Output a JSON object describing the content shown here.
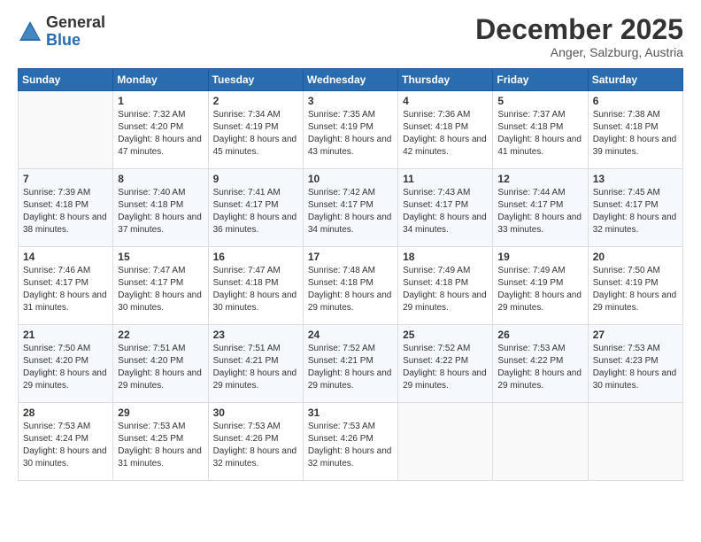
{
  "logo": {
    "general": "General",
    "blue": "Blue"
  },
  "header": {
    "month": "December 2025",
    "location": "Anger, Salzburg, Austria"
  },
  "weekdays": [
    "Sunday",
    "Monday",
    "Tuesday",
    "Wednesday",
    "Thursday",
    "Friday",
    "Saturday"
  ],
  "weeks": [
    [
      {
        "day": "",
        "sunrise": "",
        "sunset": "",
        "daylight": ""
      },
      {
        "day": "1",
        "sunrise": "Sunrise: 7:32 AM",
        "sunset": "Sunset: 4:20 PM",
        "daylight": "Daylight: 8 hours and 47 minutes."
      },
      {
        "day": "2",
        "sunrise": "Sunrise: 7:34 AM",
        "sunset": "Sunset: 4:19 PM",
        "daylight": "Daylight: 8 hours and 45 minutes."
      },
      {
        "day": "3",
        "sunrise": "Sunrise: 7:35 AM",
        "sunset": "Sunset: 4:19 PM",
        "daylight": "Daylight: 8 hours and 43 minutes."
      },
      {
        "day": "4",
        "sunrise": "Sunrise: 7:36 AM",
        "sunset": "Sunset: 4:18 PM",
        "daylight": "Daylight: 8 hours and 42 minutes."
      },
      {
        "day": "5",
        "sunrise": "Sunrise: 7:37 AM",
        "sunset": "Sunset: 4:18 PM",
        "daylight": "Daylight: 8 hours and 41 minutes."
      },
      {
        "day": "6",
        "sunrise": "Sunrise: 7:38 AM",
        "sunset": "Sunset: 4:18 PM",
        "daylight": "Daylight: 8 hours and 39 minutes."
      }
    ],
    [
      {
        "day": "7",
        "sunrise": "Sunrise: 7:39 AM",
        "sunset": "Sunset: 4:18 PM",
        "daylight": "Daylight: 8 hours and 38 minutes."
      },
      {
        "day": "8",
        "sunrise": "Sunrise: 7:40 AM",
        "sunset": "Sunset: 4:18 PM",
        "daylight": "Daylight: 8 hours and 37 minutes."
      },
      {
        "day": "9",
        "sunrise": "Sunrise: 7:41 AM",
        "sunset": "Sunset: 4:17 PM",
        "daylight": "Daylight: 8 hours and 36 minutes."
      },
      {
        "day": "10",
        "sunrise": "Sunrise: 7:42 AM",
        "sunset": "Sunset: 4:17 PM",
        "daylight": "Daylight: 8 hours and 34 minutes."
      },
      {
        "day": "11",
        "sunrise": "Sunrise: 7:43 AM",
        "sunset": "Sunset: 4:17 PM",
        "daylight": "Daylight: 8 hours and 34 minutes."
      },
      {
        "day": "12",
        "sunrise": "Sunrise: 7:44 AM",
        "sunset": "Sunset: 4:17 PM",
        "daylight": "Daylight: 8 hours and 33 minutes."
      },
      {
        "day": "13",
        "sunrise": "Sunrise: 7:45 AM",
        "sunset": "Sunset: 4:17 PM",
        "daylight": "Daylight: 8 hours and 32 minutes."
      }
    ],
    [
      {
        "day": "14",
        "sunrise": "Sunrise: 7:46 AM",
        "sunset": "Sunset: 4:17 PM",
        "daylight": "Daylight: 8 hours and 31 minutes."
      },
      {
        "day": "15",
        "sunrise": "Sunrise: 7:47 AM",
        "sunset": "Sunset: 4:17 PM",
        "daylight": "Daylight: 8 hours and 30 minutes."
      },
      {
        "day": "16",
        "sunrise": "Sunrise: 7:47 AM",
        "sunset": "Sunset: 4:18 PM",
        "daylight": "Daylight: 8 hours and 30 minutes."
      },
      {
        "day": "17",
        "sunrise": "Sunrise: 7:48 AM",
        "sunset": "Sunset: 4:18 PM",
        "daylight": "Daylight: 8 hours and 29 minutes."
      },
      {
        "day": "18",
        "sunrise": "Sunrise: 7:49 AM",
        "sunset": "Sunset: 4:18 PM",
        "daylight": "Daylight: 8 hours and 29 minutes."
      },
      {
        "day": "19",
        "sunrise": "Sunrise: 7:49 AM",
        "sunset": "Sunset: 4:19 PM",
        "daylight": "Daylight: 8 hours and 29 minutes."
      },
      {
        "day": "20",
        "sunrise": "Sunrise: 7:50 AM",
        "sunset": "Sunset: 4:19 PM",
        "daylight": "Daylight: 8 hours and 29 minutes."
      }
    ],
    [
      {
        "day": "21",
        "sunrise": "Sunrise: 7:50 AM",
        "sunset": "Sunset: 4:20 PM",
        "daylight": "Daylight: 8 hours and 29 minutes."
      },
      {
        "day": "22",
        "sunrise": "Sunrise: 7:51 AM",
        "sunset": "Sunset: 4:20 PM",
        "daylight": "Daylight: 8 hours and 29 minutes."
      },
      {
        "day": "23",
        "sunrise": "Sunrise: 7:51 AM",
        "sunset": "Sunset: 4:21 PM",
        "daylight": "Daylight: 8 hours and 29 minutes."
      },
      {
        "day": "24",
        "sunrise": "Sunrise: 7:52 AM",
        "sunset": "Sunset: 4:21 PM",
        "daylight": "Daylight: 8 hours and 29 minutes."
      },
      {
        "day": "25",
        "sunrise": "Sunrise: 7:52 AM",
        "sunset": "Sunset: 4:22 PM",
        "daylight": "Daylight: 8 hours and 29 minutes."
      },
      {
        "day": "26",
        "sunrise": "Sunrise: 7:53 AM",
        "sunset": "Sunset: 4:22 PM",
        "daylight": "Daylight: 8 hours and 29 minutes."
      },
      {
        "day": "27",
        "sunrise": "Sunrise: 7:53 AM",
        "sunset": "Sunset: 4:23 PM",
        "daylight": "Daylight: 8 hours and 30 minutes."
      }
    ],
    [
      {
        "day": "28",
        "sunrise": "Sunrise: 7:53 AM",
        "sunset": "Sunset: 4:24 PM",
        "daylight": "Daylight: 8 hours and 30 minutes."
      },
      {
        "day": "29",
        "sunrise": "Sunrise: 7:53 AM",
        "sunset": "Sunset: 4:25 PM",
        "daylight": "Daylight: 8 hours and 31 minutes."
      },
      {
        "day": "30",
        "sunrise": "Sunrise: 7:53 AM",
        "sunset": "Sunset: 4:26 PM",
        "daylight": "Daylight: 8 hours and 32 minutes."
      },
      {
        "day": "31",
        "sunrise": "Sunrise: 7:53 AM",
        "sunset": "Sunset: 4:26 PM",
        "daylight": "Daylight: 8 hours and 32 minutes."
      },
      {
        "day": "",
        "sunrise": "",
        "sunset": "",
        "daylight": ""
      },
      {
        "day": "",
        "sunrise": "",
        "sunset": "",
        "daylight": ""
      },
      {
        "day": "",
        "sunrise": "",
        "sunset": "",
        "daylight": ""
      }
    ]
  ]
}
